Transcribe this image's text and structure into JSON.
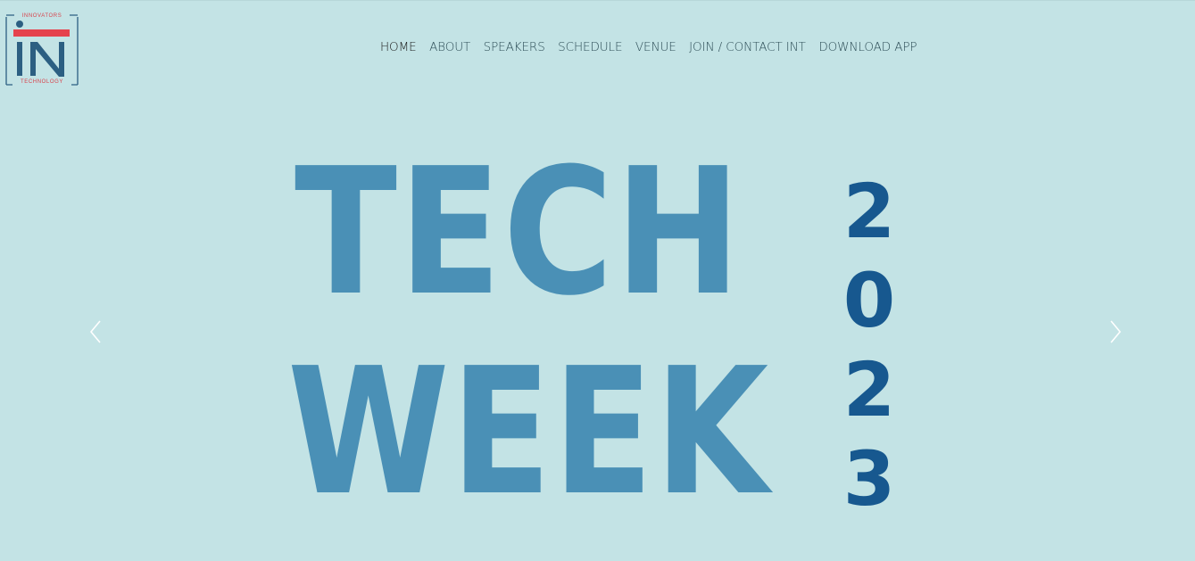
{
  "logo": {
    "top_text": "INNOVATORS",
    "bottom_text": "TECHNOLOGY",
    "icon": "in-logo-icon",
    "colors": {
      "red": "#e5424d",
      "blue": "#2c5f82"
    }
  },
  "nav": {
    "items": [
      {
        "label": "HOME",
        "active": true
      },
      {
        "label": "ABOUT"
      },
      {
        "label": "SPEAKERS"
      },
      {
        "label": "SCHEDULE"
      },
      {
        "label": "VENUE"
      },
      {
        "label": "JOIN / CONTACT INT"
      },
      {
        "label": "DOWNLOAD APP"
      }
    ]
  },
  "hero": {
    "line1": "TECH",
    "line2": "WEEK",
    "year_digits": [
      "2",
      "0",
      "2",
      "3"
    ],
    "prev_icon": "chevron-left-icon",
    "next_icon": "chevron-right-icon",
    "background": "#c3e3e5",
    "title_color": "#4a90b6",
    "year_color": "#17588f"
  }
}
